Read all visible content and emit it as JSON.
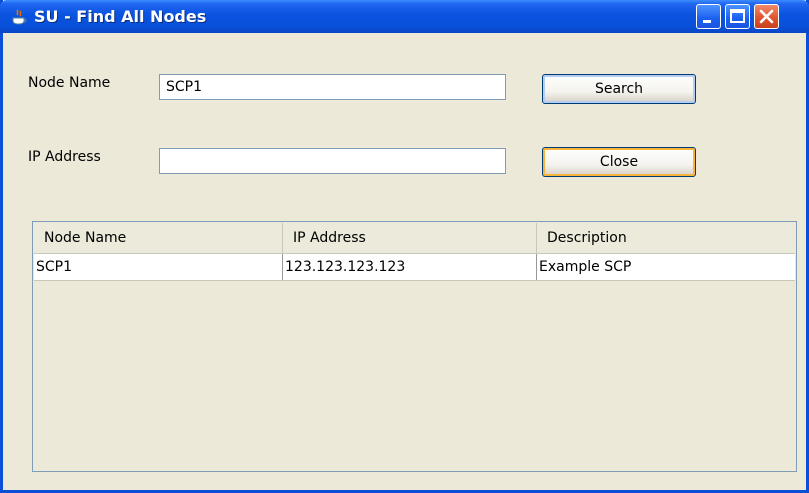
{
  "window": {
    "title": "SU - Find All Nodes"
  },
  "form": {
    "node_name_label": "Node Name",
    "node_name_value": "SCP1",
    "ip_address_label": "IP Address",
    "ip_address_value": "",
    "search_label": "Search",
    "close_label": "Close"
  },
  "table": {
    "columns": [
      "Node Name",
      "IP Address",
      "Description"
    ],
    "rows": [
      [
        "SCP1",
        "123.123.123.123",
        "Example SCP"
      ]
    ]
  },
  "colors": {
    "titlebar": "#0a53e0",
    "focus_ring": "#f8b33a",
    "window_bg": "#ece9d8"
  }
}
